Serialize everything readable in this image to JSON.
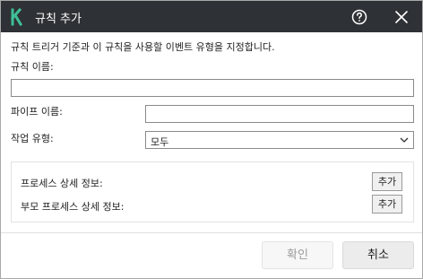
{
  "window": {
    "title": "규칙 추가",
    "logo_letter": "K",
    "logo_color": "#3fbf97",
    "titlebar_color": "#2e3135"
  },
  "form": {
    "description": "규칙 트리거 기준과 이 규칙을 사용할 이벤트 유형을 지정합니다.",
    "rule_name_label": "규칙 이름:",
    "rule_name_value": "",
    "pipe_name_label": "파이프 이름:",
    "pipe_name_value": "",
    "operation_type_label": "작업 유형:",
    "operation_type_value": "모두"
  },
  "details": {
    "process_label": "프로세스 상세 정보:",
    "process_add": "추가",
    "parent_process_label": "부모 프로세스 상세 정보:",
    "parent_process_add": "추가"
  },
  "footer": {
    "ok_label": "확인",
    "cancel_label": "취소"
  },
  "icons": {
    "help": "help-circle-icon",
    "close": "close-icon",
    "dropdown": "chevron-down-icon"
  }
}
